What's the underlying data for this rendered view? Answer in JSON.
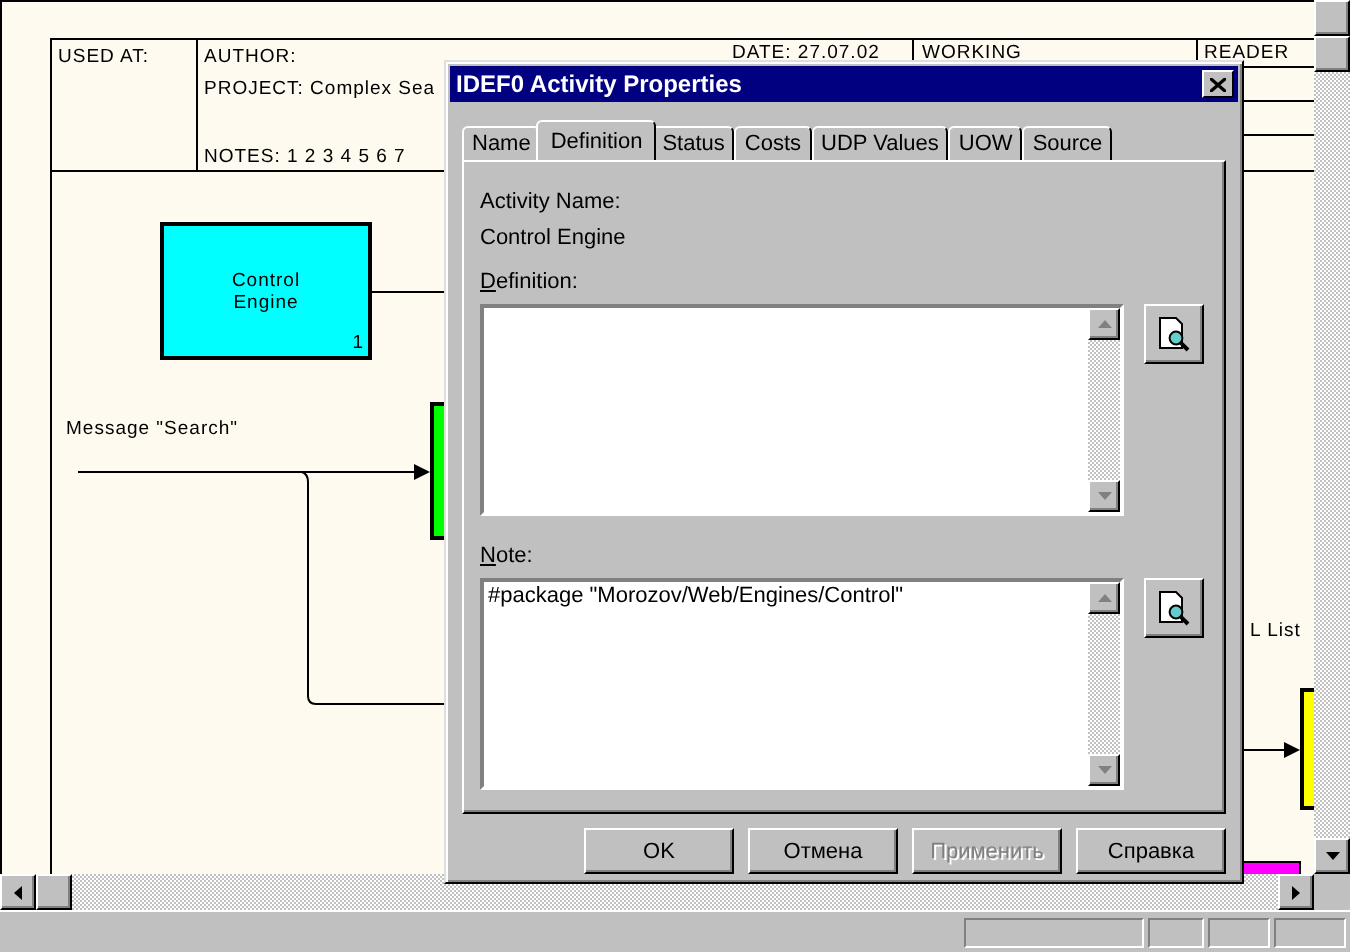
{
  "diagram": {
    "title_block": {
      "used_at": "USED AT:",
      "author": "AUTHOR:",
      "project": "PROJECT:  Complex Sea",
      "notes": "NOTES:  1  2  3  4  5  6  7",
      "date": "DATE: 27.07.02",
      "status": "WORKING",
      "reader": "READER"
    },
    "boxes": [
      {
        "label": "Control Engine",
        "number": "1"
      }
    ],
    "arrow_labels": [
      "Message \"Search\"",
      "L List"
    ]
  },
  "dialog": {
    "title": "IDEF0 Activity Properties",
    "tabs": [
      {
        "label": "Name",
        "selected": false
      },
      {
        "label": "Definition",
        "selected": true
      },
      {
        "label": "Status",
        "selected": false
      },
      {
        "label": "Costs",
        "selected": false
      },
      {
        "label": "UDP Values",
        "selected": false
      },
      {
        "label": "UOW",
        "selected": false
      },
      {
        "label": "Source",
        "selected": false
      }
    ],
    "activity_name_label": "Activity Name:",
    "activity_name": "Control Engine",
    "fields": [
      {
        "label": "Definition:"
      },
      {
        "label": "Note:",
        "value": "#package \"Morozov/Web/Engines/Control\""
      }
    ],
    "buttons": [
      {
        "label": "OK",
        "disabled": false
      },
      {
        "label": "Отмена",
        "disabled": false
      },
      {
        "label": "Применить",
        "disabled": true
      },
      {
        "label": "Справка",
        "disabled": false
      }
    ]
  }
}
